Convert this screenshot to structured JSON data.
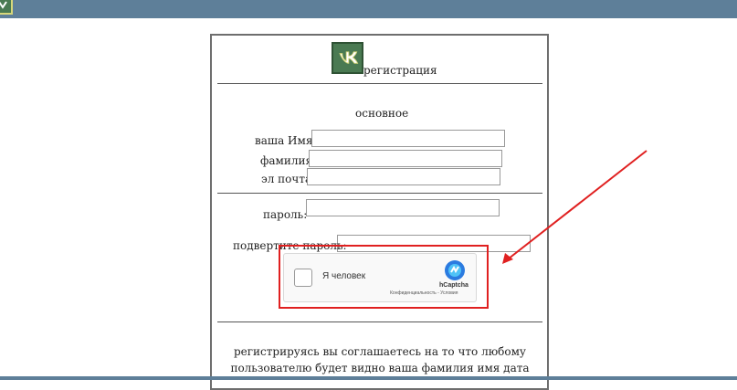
{
  "form": {
    "title": "регистрация",
    "section_main": "основное",
    "first_name_label": "ваша Имя",
    "last_name_label": "фамилия",
    "email_label": "эл почта",
    "password_label": "пароль:",
    "confirm_password_label": "подвертите пароль:",
    "first_name_value": "",
    "last_name_value": "",
    "email_value": "",
    "password_value": "",
    "confirm_password_value": ""
  },
  "captcha": {
    "label": "Я человек",
    "brand": "hCaptcha",
    "links": "Конфиденциальность - Условия"
  },
  "agreement": {
    "line1": "регистрируясь вы соглашаетесь на то что любому",
    "line2": "пользователю будет видно ваша фамилия имя дата"
  },
  "colors": {
    "topbar": "#5e7f99",
    "logo_green": "#4a7a52",
    "highlight_red": "#e02020"
  }
}
